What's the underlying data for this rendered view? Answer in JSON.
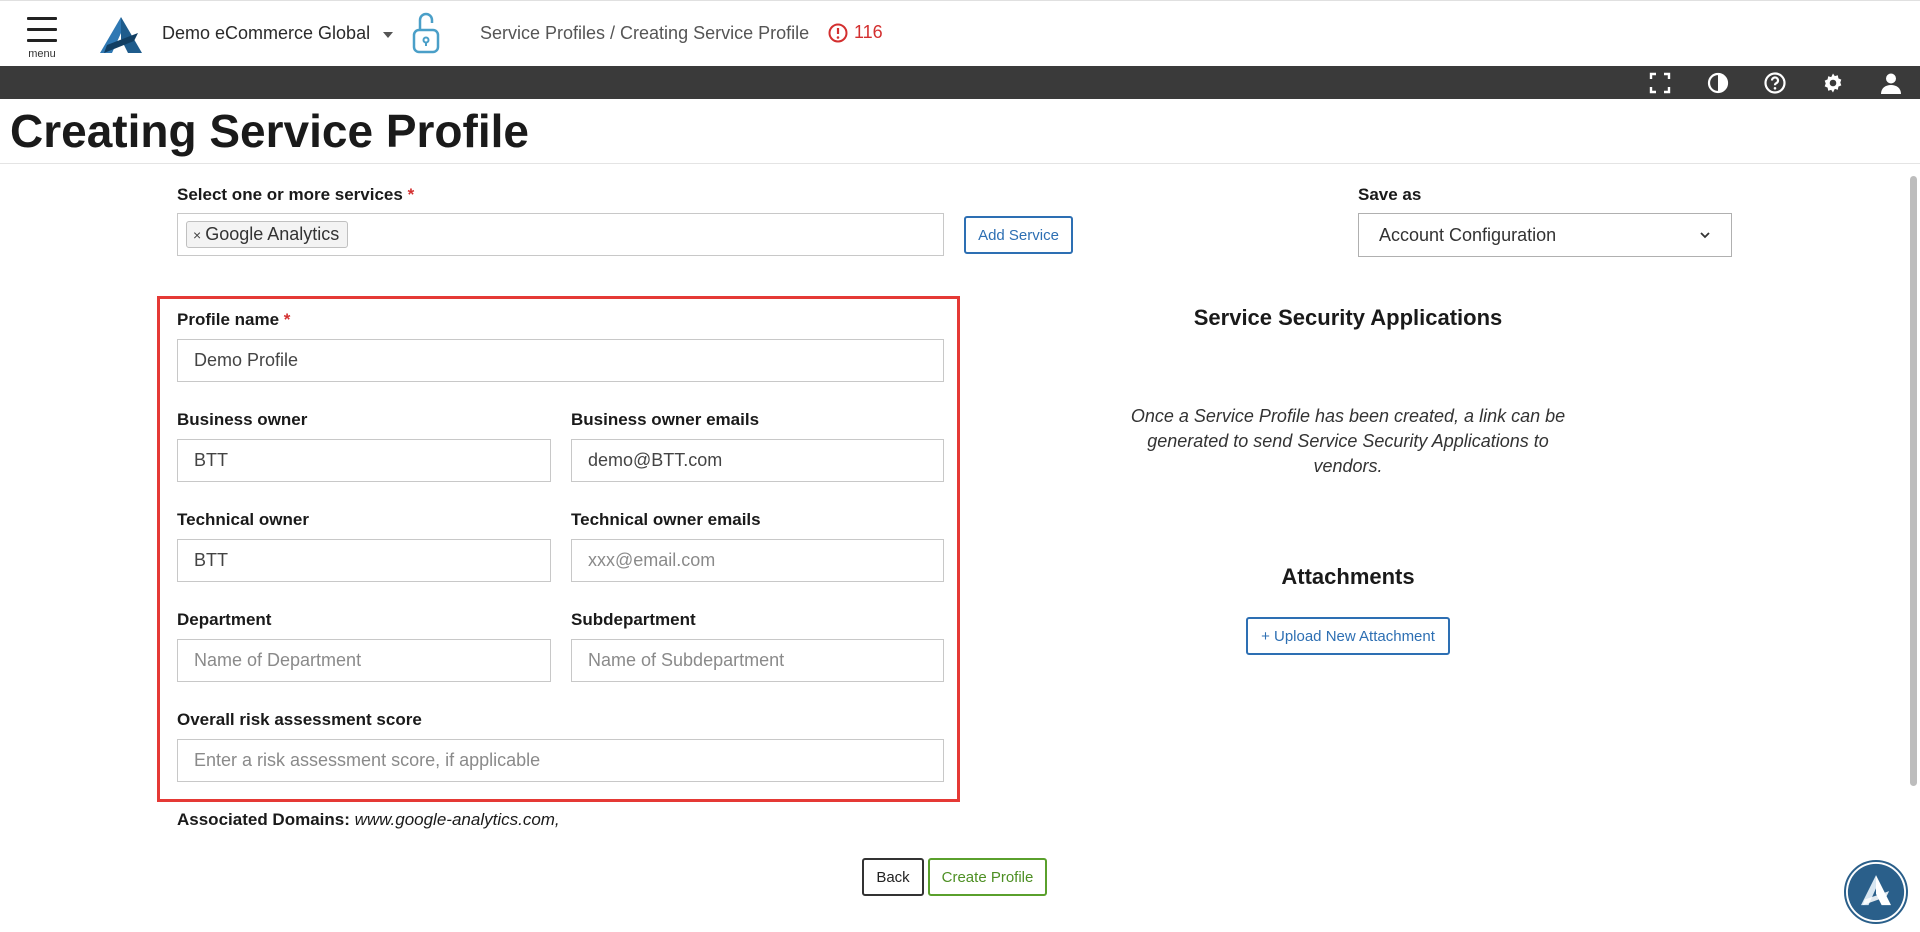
{
  "header": {
    "menu_label": "menu",
    "org_name": "Demo eCommerce Global",
    "breadcrumb": "Service Profiles / Creating Service Profile",
    "alert_count": "116"
  },
  "toolbar_icons": [
    "fullscreen-icon",
    "contrast-icon",
    "help-icon",
    "settings-icon",
    "user-icon"
  ],
  "page": {
    "title": "Creating Service Profile"
  },
  "services": {
    "label": "Select one or more services",
    "required_mark": "*",
    "selected": [
      {
        "remove": "×",
        "label": "Google Analytics"
      }
    ],
    "add_button": "Add Service"
  },
  "save_as": {
    "label": "Save as",
    "value": "Account Configuration"
  },
  "form": {
    "profile_name": {
      "label": "Profile name",
      "required_mark": "*",
      "value": "Demo Profile"
    },
    "business_owner": {
      "label": "Business owner",
      "value": "BTT"
    },
    "business_owner_emails": {
      "label": "Business owner emails",
      "value": "demo@BTT.com"
    },
    "technical_owner": {
      "label": "Technical owner",
      "value": "BTT"
    },
    "technical_owner_emails": {
      "label": "Technical owner emails",
      "placeholder": "xxx@email.com"
    },
    "department": {
      "label": "Department",
      "placeholder": "Name of Department"
    },
    "subdepartment": {
      "label": "Subdepartment",
      "placeholder": "Name of Subdepartment"
    },
    "risk_score": {
      "label": "Overall risk assessment score",
      "placeholder": "Enter a risk assessment score, if applicable"
    }
  },
  "security": {
    "heading": "Service Security Applications",
    "description": "Once a Service Profile has been created, a link can be generated to send Service Security Applications to vendors."
  },
  "attachments": {
    "heading": "Attachments",
    "upload_button": "+ Upload New Attachment"
  },
  "domains": {
    "label": "Associated Domains:",
    "value": "www.google-analytics.com,"
  },
  "actions": {
    "back": "Back",
    "create": "Create Profile"
  },
  "colors": {
    "accent": "#2d6fb3",
    "alert": "#d32f2f",
    "create": "#5aa02c",
    "highlight": "#e53935",
    "toolbar": "#3a3a3a"
  }
}
